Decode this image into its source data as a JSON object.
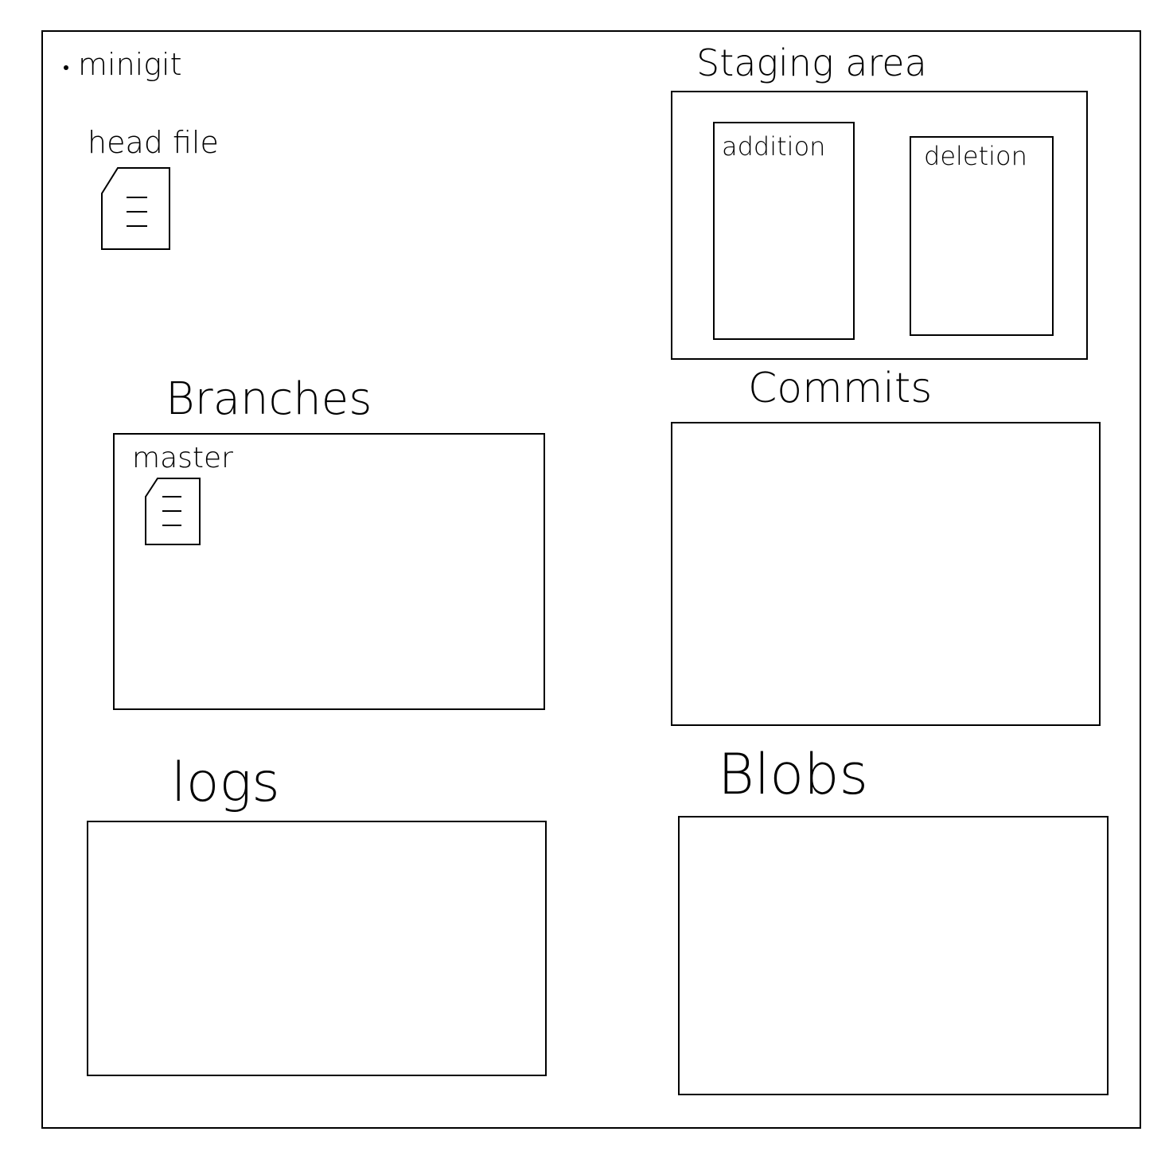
{
  "root": {
    "label": "minigit"
  },
  "head_file": {
    "label": "head file",
    "icon": "document-icon"
  },
  "staging_area": {
    "title": "Staging area",
    "addition": {
      "label": "addition"
    },
    "deletion": {
      "label": "deletion"
    }
  },
  "branches": {
    "title": "Branches",
    "master": {
      "label": "master",
      "icon": "document-icon"
    }
  },
  "commits": {
    "title": "Commits"
  },
  "logs": {
    "title": "logs"
  },
  "blobs": {
    "title": "Blobs"
  }
}
